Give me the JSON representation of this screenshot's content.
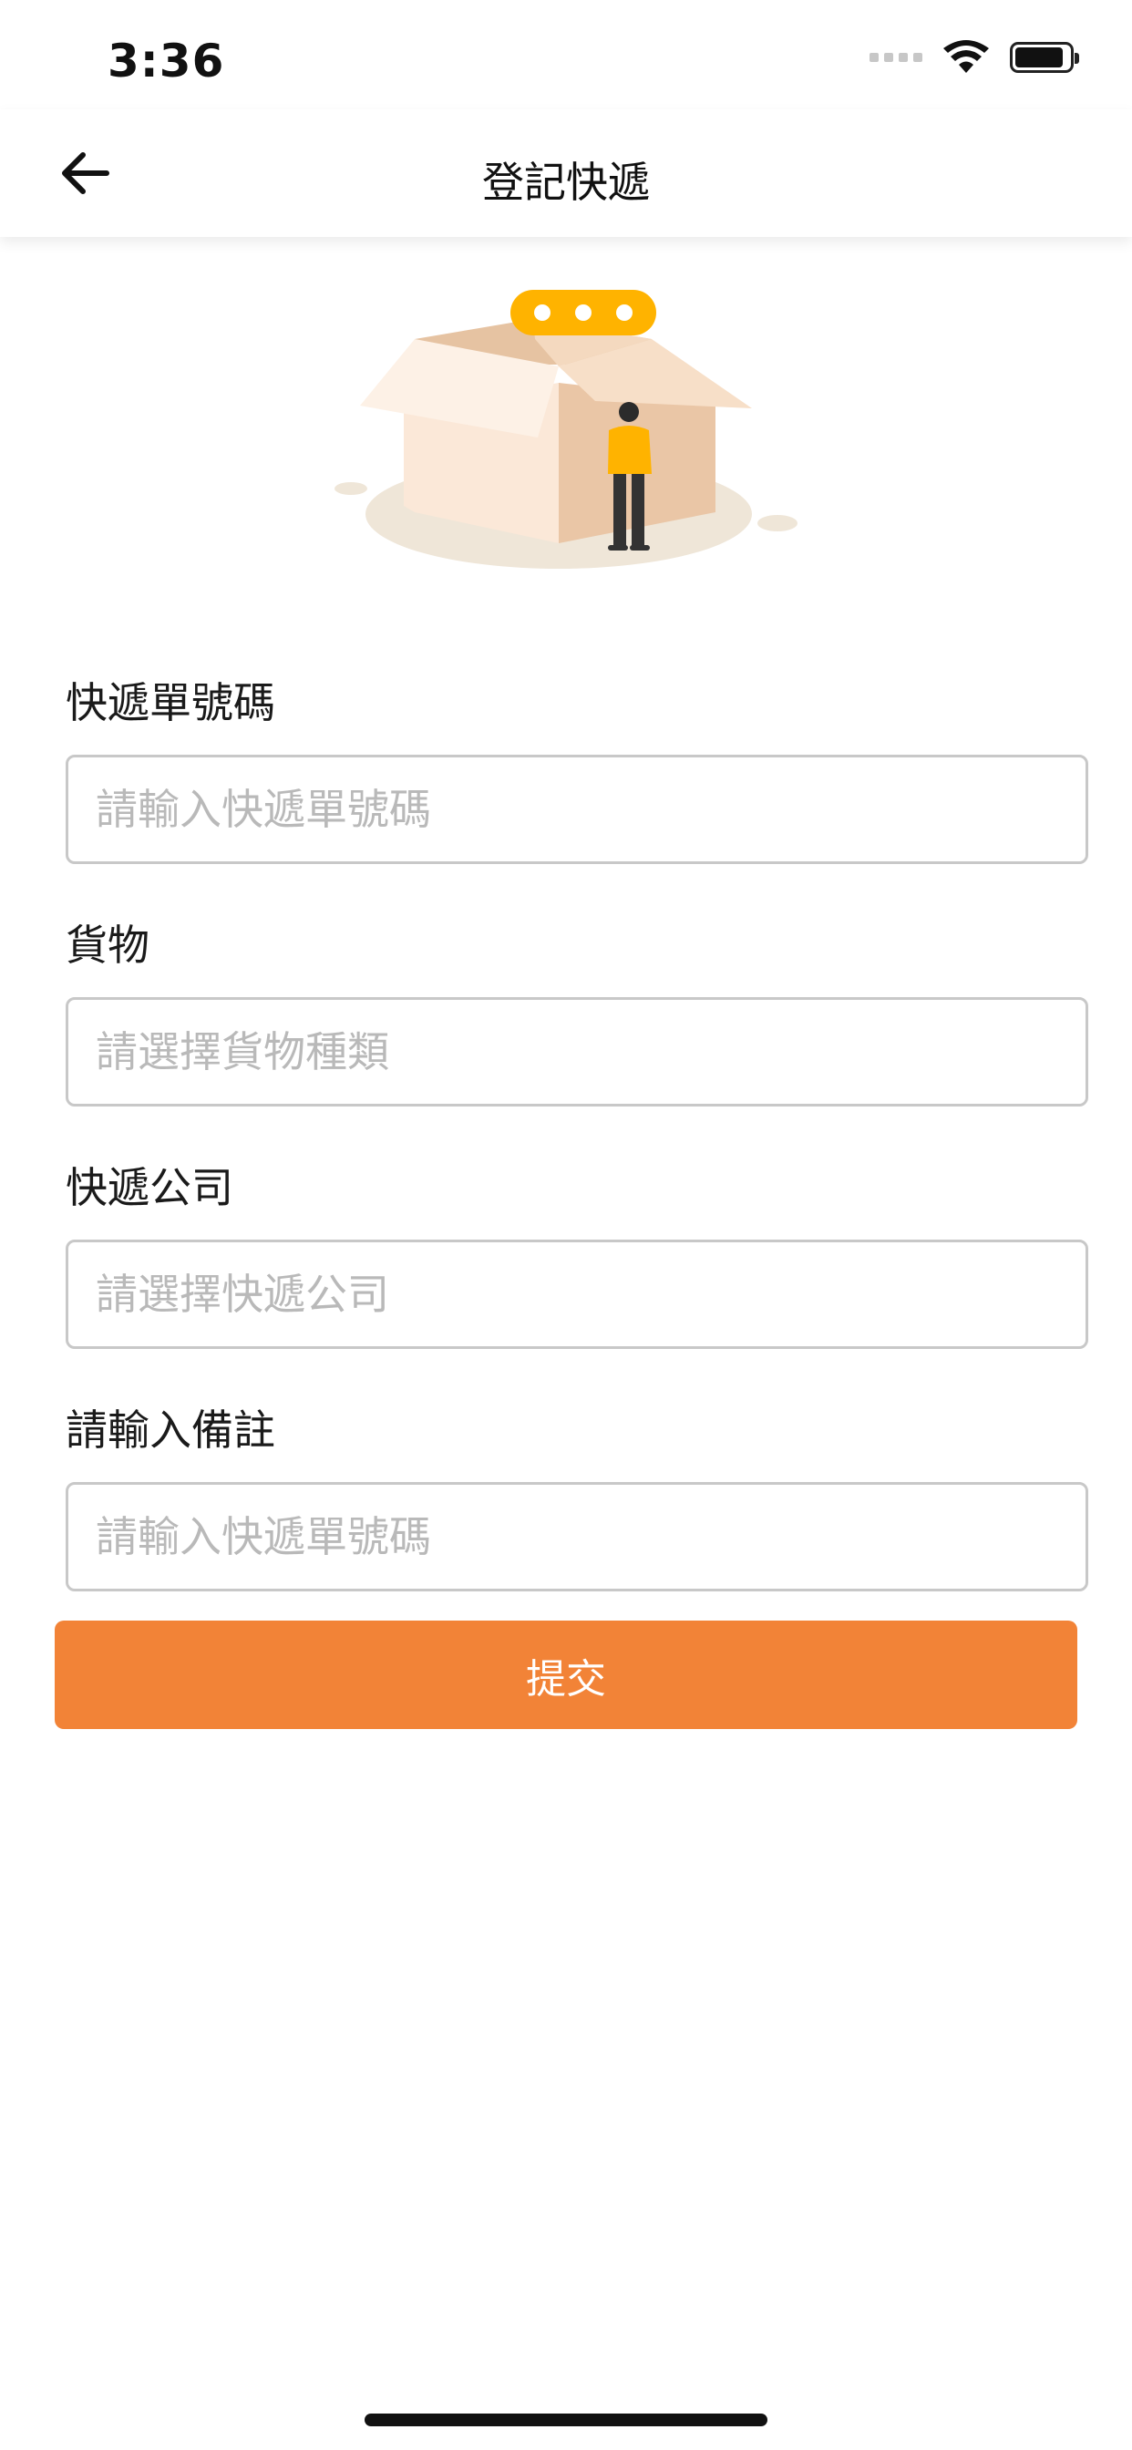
{
  "status_bar": {
    "time": "3:36",
    "battery_level": 0.9
  },
  "nav": {
    "title": "登記快遞",
    "back_icon": "arrow-left-icon"
  },
  "form": {
    "fields": [
      {
        "label": "快遞單號碼",
        "placeholder": "請輸入快遞單號碼",
        "value": ""
      },
      {
        "label": "貨物",
        "placeholder": "請選擇貨物種類",
        "value": ""
      },
      {
        "label": "快遞公司",
        "placeholder": "請選擇快遞公司",
        "value": ""
      },
      {
        "label": "請輸入備註",
        "placeholder": "請輸入快遞單號碼",
        "value": ""
      }
    ],
    "submit_label": "提交"
  },
  "colors": {
    "accent": "#f28337",
    "illustration_yellow": "#ffb300",
    "box_light": "#fbe6d4",
    "box_dark": "#e8c4a0"
  }
}
